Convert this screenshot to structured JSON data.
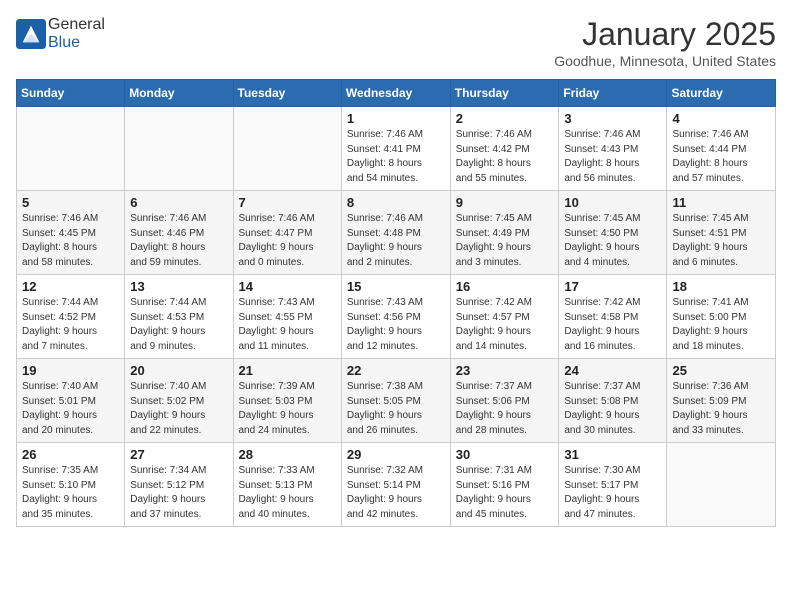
{
  "header": {
    "logo_general": "General",
    "logo_blue": "Blue",
    "month": "January 2025",
    "location": "Goodhue, Minnesota, United States"
  },
  "days_of_week": [
    "Sunday",
    "Monday",
    "Tuesday",
    "Wednesday",
    "Thursday",
    "Friday",
    "Saturday"
  ],
  "weeks": [
    [
      {
        "day": "",
        "info": ""
      },
      {
        "day": "",
        "info": ""
      },
      {
        "day": "",
        "info": ""
      },
      {
        "day": "1",
        "info": "Sunrise: 7:46 AM\nSunset: 4:41 PM\nDaylight: 8 hours\nand 54 minutes."
      },
      {
        "day": "2",
        "info": "Sunrise: 7:46 AM\nSunset: 4:42 PM\nDaylight: 8 hours\nand 55 minutes."
      },
      {
        "day": "3",
        "info": "Sunrise: 7:46 AM\nSunset: 4:43 PM\nDaylight: 8 hours\nand 56 minutes."
      },
      {
        "day": "4",
        "info": "Sunrise: 7:46 AM\nSunset: 4:44 PM\nDaylight: 8 hours\nand 57 minutes."
      }
    ],
    [
      {
        "day": "5",
        "info": "Sunrise: 7:46 AM\nSunset: 4:45 PM\nDaylight: 8 hours\nand 58 minutes."
      },
      {
        "day": "6",
        "info": "Sunrise: 7:46 AM\nSunset: 4:46 PM\nDaylight: 8 hours\nand 59 minutes."
      },
      {
        "day": "7",
        "info": "Sunrise: 7:46 AM\nSunset: 4:47 PM\nDaylight: 9 hours\nand 0 minutes."
      },
      {
        "day": "8",
        "info": "Sunrise: 7:46 AM\nSunset: 4:48 PM\nDaylight: 9 hours\nand 2 minutes."
      },
      {
        "day": "9",
        "info": "Sunrise: 7:45 AM\nSunset: 4:49 PM\nDaylight: 9 hours\nand 3 minutes."
      },
      {
        "day": "10",
        "info": "Sunrise: 7:45 AM\nSunset: 4:50 PM\nDaylight: 9 hours\nand 4 minutes."
      },
      {
        "day": "11",
        "info": "Sunrise: 7:45 AM\nSunset: 4:51 PM\nDaylight: 9 hours\nand 6 minutes."
      }
    ],
    [
      {
        "day": "12",
        "info": "Sunrise: 7:44 AM\nSunset: 4:52 PM\nDaylight: 9 hours\nand 7 minutes."
      },
      {
        "day": "13",
        "info": "Sunrise: 7:44 AM\nSunset: 4:53 PM\nDaylight: 9 hours\nand 9 minutes."
      },
      {
        "day": "14",
        "info": "Sunrise: 7:43 AM\nSunset: 4:55 PM\nDaylight: 9 hours\nand 11 minutes."
      },
      {
        "day": "15",
        "info": "Sunrise: 7:43 AM\nSunset: 4:56 PM\nDaylight: 9 hours\nand 12 minutes."
      },
      {
        "day": "16",
        "info": "Sunrise: 7:42 AM\nSunset: 4:57 PM\nDaylight: 9 hours\nand 14 minutes."
      },
      {
        "day": "17",
        "info": "Sunrise: 7:42 AM\nSunset: 4:58 PM\nDaylight: 9 hours\nand 16 minutes."
      },
      {
        "day": "18",
        "info": "Sunrise: 7:41 AM\nSunset: 5:00 PM\nDaylight: 9 hours\nand 18 minutes."
      }
    ],
    [
      {
        "day": "19",
        "info": "Sunrise: 7:40 AM\nSunset: 5:01 PM\nDaylight: 9 hours\nand 20 minutes."
      },
      {
        "day": "20",
        "info": "Sunrise: 7:40 AM\nSunset: 5:02 PM\nDaylight: 9 hours\nand 22 minutes."
      },
      {
        "day": "21",
        "info": "Sunrise: 7:39 AM\nSunset: 5:03 PM\nDaylight: 9 hours\nand 24 minutes."
      },
      {
        "day": "22",
        "info": "Sunrise: 7:38 AM\nSunset: 5:05 PM\nDaylight: 9 hours\nand 26 minutes."
      },
      {
        "day": "23",
        "info": "Sunrise: 7:37 AM\nSunset: 5:06 PM\nDaylight: 9 hours\nand 28 minutes."
      },
      {
        "day": "24",
        "info": "Sunrise: 7:37 AM\nSunset: 5:08 PM\nDaylight: 9 hours\nand 30 minutes."
      },
      {
        "day": "25",
        "info": "Sunrise: 7:36 AM\nSunset: 5:09 PM\nDaylight: 9 hours\nand 33 minutes."
      }
    ],
    [
      {
        "day": "26",
        "info": "Sunrise: 7:35 AM\nSunset: 5:10 PM\nDaylight: 9 hours\nand 35 minutes."
      },
      {
        "day": "27",
        "info": "Sunrise: 7:34 AM\nSunset: 5:12 PM\nDaylight: 9 hours\nand 37 minutes."
      },
      {
        "day": "28",
        "info": "Sunrise: 7:33 AM\nSunset: 5:13 PM\nDaylight: 9 hours\nand 40 minutes."
      },
      {
        "day": "29",
        "info": "Sunrise: 7:32 AM\nSunset: 5:14 PM\nDaylight: 9 hours\nand 42 minutes."
      },
      {
        "day": "30",
        "info": "Sunrise: 7:31 AM\nSunset: 5:16 PM\nDaylight: 9 hours\nand 45 minutes."
      },
      {
        "day": "31",
        "info": "Sunrise: 7:30 AM\nSunset: 5:17 PM\nDaylight: 9 hours\nand 47 minutes."
      },
      {
        "day": "",
        "info": ""
      }
    ]
  ]
}
